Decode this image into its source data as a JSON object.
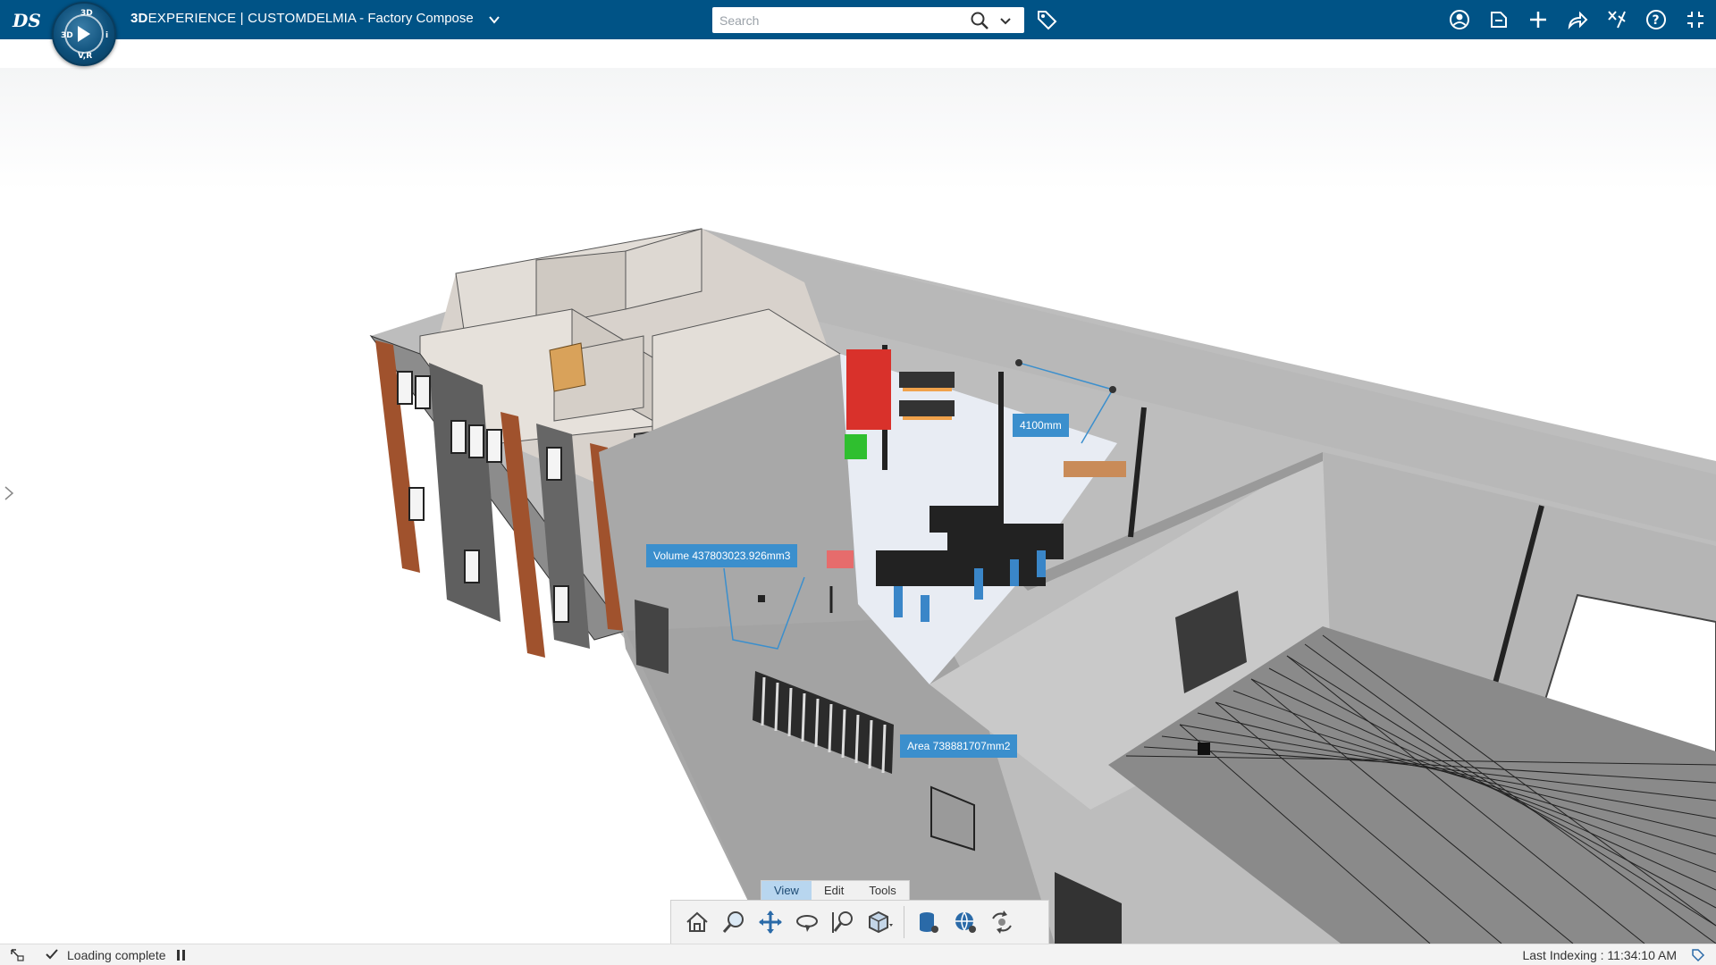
{
  "header": {
    "brand_bold": "3D",
    "brand_rest": "EXPERIENCE | CUSTOM",
    "app_name": "DELMIA - Factory Compose",
    "compass": {
      "top": "3D",
      "left": "3D",
      "right": "i",
      "bottom": "V,R"
    },
    "search": {
      "placeholder": "Search"
    },
    "icons": [
      "ds-logo-icon",
      "compass-icon",
      "chevron-down-icon",
      "search-icon",
      "tag-icon",
      "user-icon",
      "share-icon",
      "plus-icon",
      "share-arrow-icon",
      "tools-icon",
      "help-icon",
      "fullscreen-icon"
    ]
  },
  "viewport": {
    "labels": {
      "height": "4100mm",
      "volume": "Volume 437803023.926mm3",
      "area": "Area 738881707mm2"
    }
  },
  "action_bar": {
    "tabs": [
      "View",
      "Edit",
      "Tools"
    ],
    "active_tab": "View",
    "tools": [
      "home-icon",
      "zoom-icon",
      "pan-icon",
      "rotate-icon",
      "zoom-area-icon",
      "view-cube-icon",
      "database-icon",
      "globe-settings-icon",
      "sync-icon"
    ]
  },
  "status": {
    "message": "Loading complete",
    "indexing": "Last Indexing : 11:34:10 AM"
  },
  "colors": {
    "header": "#005386",
    "tag": "#3b8fcd",
    "wall": "#a9a9a9",
    "brick": "#a0522d"
  }
}
